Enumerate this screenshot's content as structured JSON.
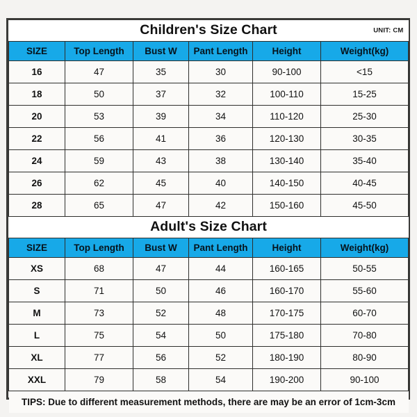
{
  "unit_label": "UNIT: CM",
  "columns": [
    "SIZE",
    "Top Length",
    "Bust W",
    "Pant Length",
    "Height",
    "Weight(kg)"
  ],
  "children": {
    "title": "Children's Size Chart",
    "rows": [
      [
        "16",
        "47",
        "35",
        "30",
        "90-100",
        "<15"
      ],
      [
        "18",
        "50",
        "37",
        "32",
        "100-110",
        "15-25"
      ],
      [
        "20",
        "53",
        "39",
        "34",
        "110-120",
        "25-30"
      ],
      [
        "22",
        "56",
        "41",
        "36",
        "120-130",
        "30-35"
      ],
      [
        "24",
        "59",
        "43",
        "38",
        "130-140",
        "35-40"
      ],
      [
        "26",
        "62",
        "45",
        "40",
        "140-150",
        "40-45"
      ],
      [
        "28",
        "65",
        "47",
        "42",
        "150-160",
        "45-50"
      ]
    ]
  },
  "adults": {
    "title": "Adult's Size Chart",
    "rows": [
      [
        "XS",
        "68",
        "47",
        "44",
        "160-165",
        "50-55"
      ],
      [
        "S",
        "71",
        "50",
        "46",
        "160-170",
        "55-60"
      ],
      [
        "M",
        "73",
        "52",
        "48",
        "170-175",
        "60-70"
      ],
      [
        "L",
        "75",
        "54",
        "50",
        "175-180",
        "70-80"
      ],
      [
        "XL",
        "77",
        "56",
        "52",
        "180-190",
        "80-90"
      ],
      [
        "XXL",
        "79",
        "58",
        "54",
        "190-200",
        "90-100"
      ]
    ]
  },
  "tips": "TIPS: Due to different measurement methods, there are may be an error of 1cm-3cm",
  "colors": {
    "header_blue": "#17a9e8",
    "tips_red": "#cf2020",
    "border": "#2e2e2c",
    "page_background": "#f4f3f1"
  },
  "chart_data": {
    "type": "table",
    "title": "Children's and Adult's Size Chart",
    "unit": "CM",
    "columns": [
      "SIZE",
      "Top Length",
      "Bust W",
      "Pant Length",
      "Height",
      "Weight(kg)"
    ],
    "tables": [
      {
        "name": "Children's Size Chart",
        "rows": [
          {
            "SIZE": "16",
            "Top Length": 47,
            "Bust W": 35,
            "Pant Length": 30,
            "Height": "90-100",
            "Weight(kg)": "<15"
          },
          {
            "SIZE": "18",
            "Top Length": 50,
            "Bust W": 37,
            "Pant Length": 32,
            "Height": "100-110",
            "Weight(kg)": "15-25"
          },
          {
            "SIZE": "20",
            "Top Length": 53,
            "Bust W": 39,
            "Pant Length": 34,
            "Height": "110-120",
            "Weight(kg)": "25-30"
          },
          {
            "SIZE": "22",
            "Top Length": 56,
            "Bust W": 41,
            "Pant Length": 36,
            "Height": "120-130",
            "Weight(kg)": "30-35"
          },
          {
            "SIZE": "24",
            "Top Length": 59,
            "Bust W": 43,
            "Pant Length": 38,
            "Height": "130-140",
            "Weight(kg)": "35-40"
          },
          {
            "SIZE": "26",
            "Top Length": 62,
            "Bust W": 45,
            "Pant Length": 40,
            "Height": "140-150",
            "Weight(kg)": "40-45"
          },
          {
            "SIZE": "28",
            "Top Length": 65,
            "Bust W": 47,
            "Pant Length": 42,
            "Height": "150-160",
            "Weight(kg)": "45-50"
          }
        ]
      },
      {
        "name": "Adult's Size Chart",
        "rows": [
          {
            "SIZE": "XS",
            "Top Length": 68,
            "Bust W": 47,
            "Pant Length": 44,
            "Height": "160-165",
            "Weight(kg)": "50-55"
          },
          {
            "SIZE": "S",
            "Top Length": 71,
            "Bust W": 50,
            "Pant Length": 46,
            "Height": "160-170",
            "Weight(kg)": "55-60"
          },
          {
            "SIZE": "M",
            "Top Length": 73,
            "Bust W": 52,
            "Pant Length": 48,
            "Height": "170-175",
            "Weight(kg)": "60-70"
          },
          {
            "SIZE": "L",
            "Top Length": 75,
            "Bust W": 54,
            "Pant Length": 50,
            "Height": "175-180",
            "Weight(kg)": "70-80"
          },
          {
            "SIZE": "XL",
            "Top Length": 77,
            "Bust W": 56,
            "Pant Length": 52,
            "Height": "180-190",
            "Weight(kg)": "80-90"
          },
          {
            "SIZE": "XXL",
            "Top Length": 79,
            "Bust W": 58,
            "Pant Length": 54,
            "Height": "190-200",
            "Weight(kg)": "90-100"
          }
        ]
      }
    ],
    "note": "TIPS: Due to different measurement methods, there are may be an error of 1cm-3cm"
  }
}
